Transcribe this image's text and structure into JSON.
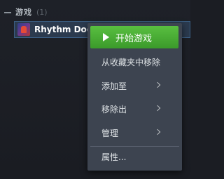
{
  "library": {
    "section": {
      "title": "游戏",
      "count": "(1)"
    },
    "game": {
      "name": "Rhythm Doctor"
    }
  },
  "context_menu": {
    "play_label": "开始游戏",
    "items": [
      {
        "label": "从收藏夹中移除",
        "submenu": false
      },
      {
        "label": "添加至",
        "submenu": true
      },
      {
        "label": "移除出",
        "submenu": true
      },
      {
        "label": "管理",
        "submenu": true
      },
      {
        "label": "属性...",
        "submenu": false
      }
    ]
  },
  "colors": {
    "accent_play": "#4fb13a",
    "menu_bg": "#3d4450",
    "selected_row": "#2b3a4e"
  }
}
